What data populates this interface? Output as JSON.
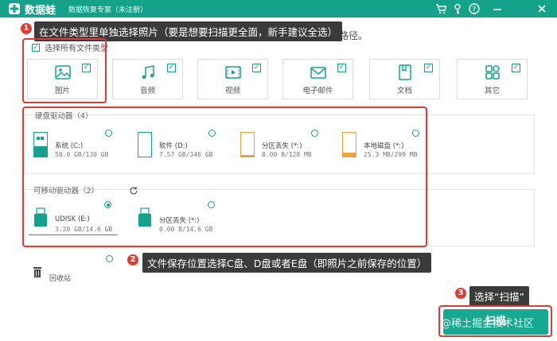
{
  "window": {
    "brand": "数据蛙",
    "subtitle": "数据恢复专家（未注册）",
    "icons": [
      "cart-icon",
      "key-icon",
      "help-icon",
      "minimize-icon",
      "close-icon"
    ]
  },
  "path_tail": "和路径。",
  "annotations": {
    "step1": {
      "num": "1",
      "text": "在文件类型里单独选择照片（要是想要扫描更全面，新手建议全选）"
    },
    "step2": {
      "num": "2",
      "text": "文件保存位置选择C盘、D盘或者E盘（即照片之前保存的位置）"
    },
    "step3": {
      "num": "3",
      "text": "选择“扫描”"
    }
  },
  "select_all": {
    "label": "选择所有文件类型",
    "checked": true
  },
  "file_types": [
    {
      "label": "图片",
      "icon": "image-icon",
      "checked": true
    },
    {
      "label": "音频",
      "icon": "music-icon",
      "checked": true
    },
    {
      "label": "视频",
      "icon": "video-icon",
      "checked": true
    },
    {
      "label": "电子邮件",
      "icon": "mail-icon",
      "checked": true
    },
    {
      "label": "文档",
      "icon": "document-icon",
      "checked": true
    },
    {
      "label": "其它",
      "icon": "apps-icon",
      "checked": true
    }
  ],
  "hard_drives": {
    "title": "硬盘驱动器（4）",
    "items": [
      {
        "name": "系统 (C:)",
        "size": "58.0 GB/130 GB",
        "icon": "system-drive-icon",
        "selected": false
      },
      {
        "name": "软件 (D:)",
        "size": "7.57 GB/346 GB",
        "icon": "drive-icon",
        "selected": false
      },
      {
        "name": "分区丢失 (*:)",
        "size": "0.00  B/128 MB",
        "icon": "lost-partition-icon",
        "selected": false
      },
      {
        "name": "本地磁盘 (*:)",
        "size": "25.3 MB/299 MB",
        "icon": "local-disk-icon",
        "selected": false
      }
    ]
  },
  "removable_drives": {
    "title": "可移动驱动器（2）",
    "refresh_icon": "refresh-icon",
    "items": [
      {
        "name": "UDISK (E:)",
        "size": "3.20 GB/14.6 GB",
        "icon": "usb-drive-icon",
        "selected": true
      },
      {
        "name": "分区丢失 (*:)",
        "size": "0.00  B/14.6 GB",
        "icon": "usb-drive-icon",
        "selected": false
      }
    ]
  },
  "recycle_bin": {
    "label": "回收站",
    "icon": "trash-icon",
    "selected": false
  },
  "scan_button": {
    "label": "扫描"
  },
  "watermark": "@稀土掘金技术社区",
  "colors": {
    "accent": "#14a38a",
    "annotation": "#e53935",
    "callout_bg": "#3b3b3b"
  }
}
